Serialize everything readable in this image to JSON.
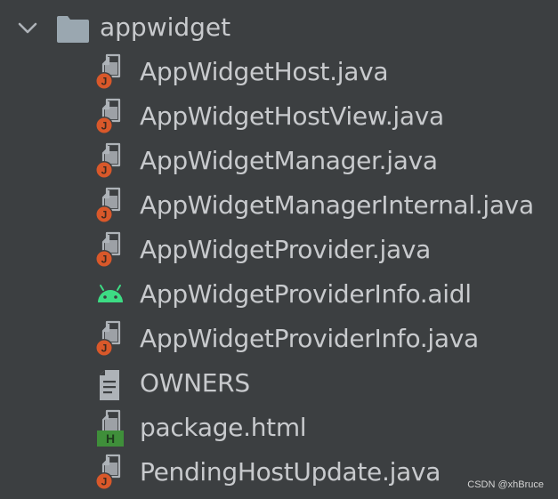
{
  "folder": {
    "name": "appwidget",
    "expanded": true,
    "icon": "folder-icon"
  },
  "files": [
    {
      "name": "AppWidgetHost.java",
      "type": "java",
      "icon": "java-class-icon"
    },
    {
      "name": "AppWidgetHostView.java",
      "type": "java",
      "icon": "java-class-icon"
    },
    {
      "name": "AppWidgetManager.java",
      "type": "java",
      "icon": "java-class-icon"
    },
    {
      "name": "AppWidgetManagerInternal.java",
      "type": "java",
      "icon": "java-class-icon"
    },
    {
      "name": "AppWidgetProvider.java",
      "type": "java",
      "icon": "java-class-icon"
    },
    {
      "name": "AppWidgetProviderInfo.aidl",
      "type": "aidl",
      "icon": "android-icon"
    },
    {
      "name": "AppWidgetProviderInfo.java",
      "type": "java",
      "icon": "java-class-icon"
    },
    {
      "name": "OWNERS",
      "type": "text",
      "icon": "text-file-icon"
    },
    {
      "name": "package.html",
      "type": "html",
      "icon": "html-file-icon"
    },
    {
      "name": "PendingHostUpdate.java",
      "type": "java",
      "icon": "java-class-icon"
    }
  ],
  "watermark": "CSDN @xhBruce",
  "colors": {
    "background": "#3c3f41",
    "text": "#c8cacd",
    "java_badge": "#d9582a",
    "android_green": "#3ddc84",
    "html_badge": "#3f8f3a",
    "file_gray": "#aeb3b8"
  }
}
